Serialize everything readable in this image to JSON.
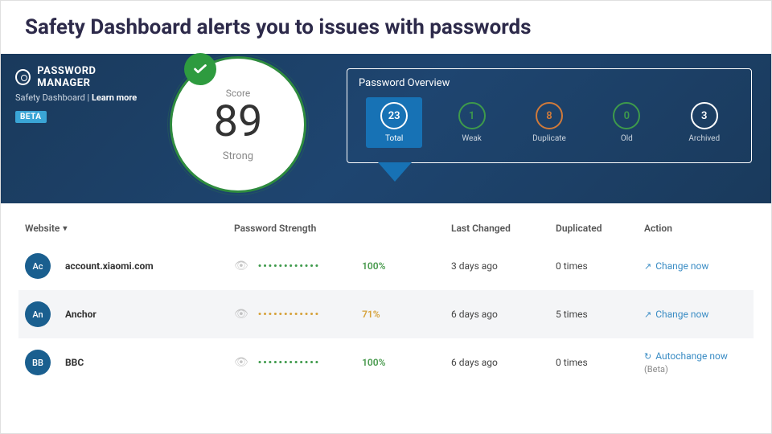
{
  "caption": "Safety Dashboard alerts you to issues with passwords",
  "brand": {
    "name": "PASSWORD MANAGER",
    "subtitle": "Safety Dashboard",
    "learn": "Learn more",
    "beta": "BETA"
  },
  "score": {
    "label": "Score",
    "value": "89",
    "word": "Strong"
  },
  "overview": {
    "title": "Password Overview",
    "items": [
      {
        "count": "23",
        "label": "Total",
        "color": "#ffffff",
        "text": "#ffffff",
        "selected": true
      },
      {
        "count": "1",
        "label": "Weak",
        "color": "#3e9a4b",
        "text": "#cdd6e0",
        "selected": false
      },
      {
        "count": "8",
        "label": "Duplicate",
        "color": "#d07a3a",
        "text": "#cdd6e0",
        "selected": false
      },
      {
        "count": "0",
        "label": "Old",
        "color": "#3e9a4b",
        "text": "#cdd6e0",
        "selected": false
      },
      {
        "count": "3",
        "label": "Archived",
        "color": "#ffffff",
        "text": "#cdd6e0",
        "selected": false
      }
    ]
  },
  "table": {
    "headers": {
      "website": "Website",
      "strength": "Password Strength",
      "last": "Last Changed",
      "dup": "Duplicated",
      "action": "Action"
    },
    "rows": [
      {
        "av": "Ac",
        "site": "account.xiaomi.com",
        "dots_color": "#3e9a4b",
        "pct": "100%",
        "pct_warn": false,
        "last": "3 days ago",
        "dup": "0 times",
        "action": "Change now",
        "action_icon": "↗",
        "beta": false
      },
      {
        "av": "An",
        "site": "Anchor",
        "dots_color": "#d6a23a",
        "pct": "71%",
        "pct_warn": true,
        "last": "6 days ago",
        "dup": "5 times",
        "action": "Change now",
        "action_icon": "↗",
        "beta": false
      },
      {
        "av": "BB",
        "site": "BBC",
        "dots_color": "#3e9a4b",
        "pct": "100%",
        "pct_warn": false,
        "last": "6 days ago",
        "dup": "0 times",
        "action": "Autochange now",
        "action_icon": "↻",
        "beta": true
      }
    ]
  },
  "beta_label": "(Beta)"
}
